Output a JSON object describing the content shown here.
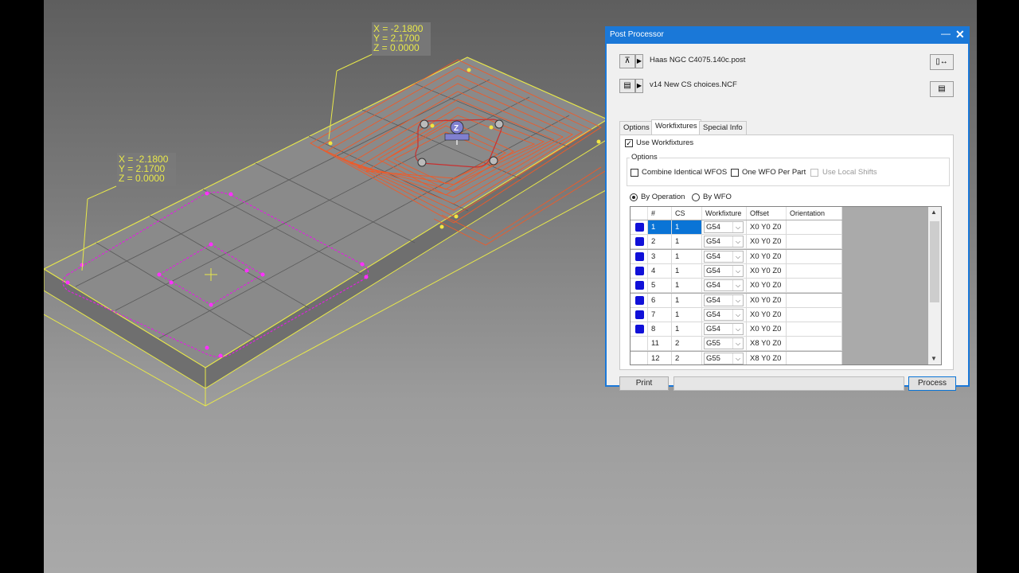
{
  "viewport": {
    "coord_label_1": {
      "x": "X = -2.1800",
      "y": "Y = 2.1700",
      "z": "Z = 0.0000"
    },
    "coord_label_2": {
      "x": "X = -2.1800",
      "y": "Y = 2.1700",
      "z": "Z = 0.0000"
    },
    "gizmo_axis": "Z"
  },
  "dialog": {
    "title": "Post Processor",
    "post_file": "Haas NGC C4075.140c.post",
    "ncf_file": "v14 New CS choices.NCF",
    "tabs": [
      {
        "label": "Options"
      },
      {
        "label": "Workfixtures"
      },
      {
        "label": "Special Info"
      }
    ],
    "use_workfixtures_label": "Use Workfixtures",
    "options_group_label": "Options",
    "combine_label": "Combine Identical WFOS",
    "one_wfo_label": "One WFO Per Part",
    "local_shifts_label": "Use Local Shifts",
    "by_operation_label": "By Operation",
    "by_wfo_label": "By WFO",
    "columns": [
      "#",
      "CS",
      "Workfixture",
      "Offset",
      "Orientation"
    ],
    "rows": [
      {
        "num": "1",
        "cs": "1",
        "wf": "G54",
        "offset": "X0 Y0 Z0",
        "orientation": "",
        "marker": true
      },
      {
        "num": "2",
        "cs": "1",
        "wf": "G54",
        "offset": "X0 Y0 Z0",
        "orientation": "",
        "marker": true
      },
      {
        "num": "3",
        "cs": "1",
        "wf": "G54",
        "offset": "X0 Y0 Z0",
        "orientation": "",
        "marker": true
      },
      {
        "num": "4",
        "cs": "1",
        "wf": "G54",
        "offset": "X0 Y0 Z0",
        "orientation": "",
        "marker": true
      },
      {
        "num": "5",
        "cs": "1",
        "wf": "G54",
        "offset": "X0 Y0 Z0",
        "orientation": "",
        "marker": true
      },
      {
        "num": "6",
        "cs": "1",
        "wf": "G54",
        "offset": "X0 Y0 Z0",
        "orientation": "",
        "marker": true
      },
      {
        "num": "7",
        "cs": "1",
        "wf": "G54",
        "offset": "X0 Y0 Z0",
        "orientation": "",
        "marker": true
      },
      {
        "num": "8",
        "cs": "1",
        "wf": "G54",
        "offset": "X0 Y0 Z0",
        "orientation": "",
        "marker": true
      },
      {
        "num": "11",
        "cs": "2",
        "wf": "G55",
        "offset": "X8 Y0 Z0",
        "orientation": "",
        "marker": false
      },
      {
        "num": "12",
        "cs": "2",
        "wf": "G55",
        "offset": "X8 Y0 Z0",
        "orientation": "",
        "marker": false
      }
    ],
    "print_label": "Print",
    "process_label": "Process"
  },
  "colors": {
    "accent": "#1a78d8",
    "selection": "#0a74d6",
    "marker": "#1010d8",
    "wire_yellow": "#e8e84a",
    "toolpath_orange": "#f05a28",
    "geometry_magenta": "#e020e0"
  }
}
